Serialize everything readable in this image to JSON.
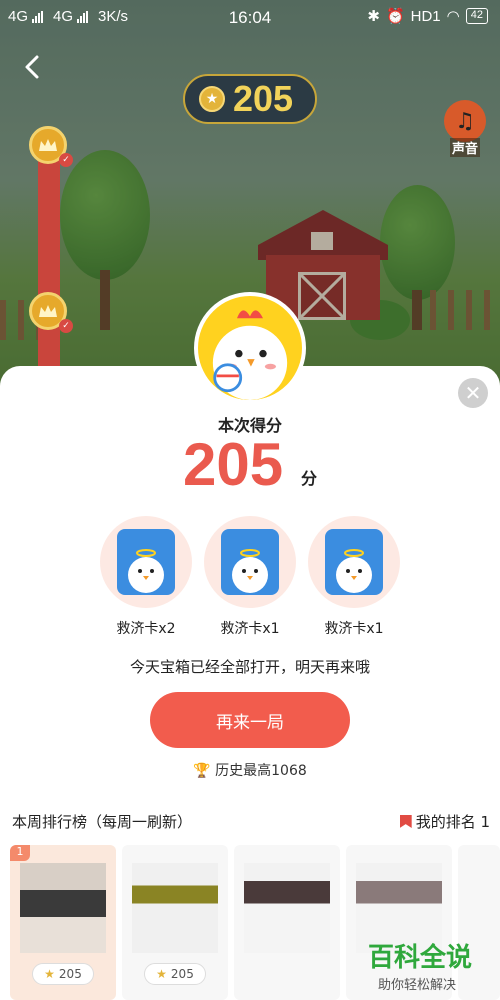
{
  "status_bar": {
    "network_1": "4G",
    "network_2": "4G",
    "speed": "3K/s",
    "time": "16:04",
    "hd": "HD1",
    "battery": "42"
  },
  "header": {
    "back_icon": "chevron-left-icon",
    "coins": "205",
    "sound_label": "声音"
  },
  "result": {
    "title": "本次得分",
    "score": "205",
    "unit": "分",
    "rewards": [
      {
        "label": "救济卡x2"
      },
      {
        "label": "救济卡x1"
      },
      {
        "label": "救济卡x1"
      }
    ],
    "notice": "今天宝箱已经全部打开，明天再来哦",
    "again_button": "再来一局",
    "history": "历史最高1068"
  },
  "leaderboard": {
    "title": "本周排行榜（每周一刷新）",
    "my_rank": "我的排名 1",
    "entries": [
      {
        "rank": "1",
        "score": "205"
      },
      {
        "rank": "",
        "score": "205"
      },
      {
        "rank": "",
        "score": ""
      },
      {
        "rank": "",
        "score": ""
      }
    ]
  },
  "watermark": {
    "title": "百科全说",
    "subtitle": "助你轻松解决"
  },
  "colors": {
    "accent": "#f25c4d",
    "score": "#ea5a4e",
    "coin": "#f2d35a"
  }
}
